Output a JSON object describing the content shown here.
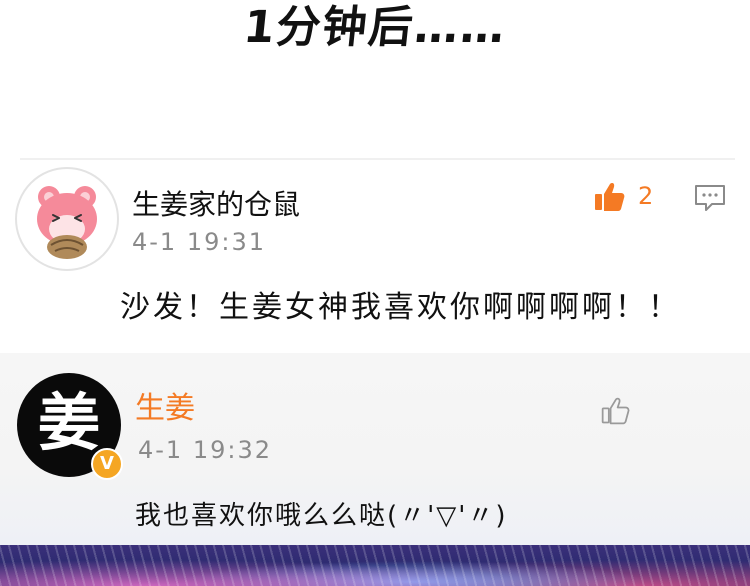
{
  "caption": "1分钟后……",
  "comments": [
    {
      "username": "生姜家的仓鼠",
      "time": "4-1  19:31",
      "like_count": "2",
      "text": "沙发！生姜女神我喜欢你啊啊啊啊！！"
    },
    {
      "username": "生姜",
      "avatar_glyph": "姜",
      "verified_badge": "V",
      "time": "4-1  19:32",
      "text": "我也喜欢你哦么么哒(〃'▽'〃)"
    }
  ],
  "colors": {
    "accent_orange": "#f47a24",
    "verified_badge": "#f5a623",
    "reply_background": "#f5f5f5"
  }
}
